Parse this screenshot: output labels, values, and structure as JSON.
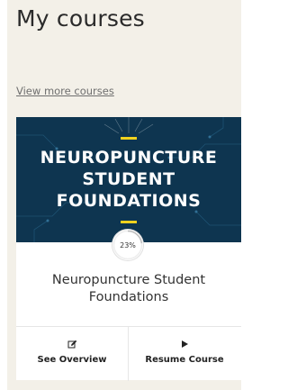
{
  "page": {
    "title": "My courses",
    "more_link": "View more courses"
  },
  "course_card": {
    "banner_lines": [
      "NEUROPUNCTURE",
      "STUDENT",
      "FOUNDATIONS"
    ],
    "banner_colors": {
      "background": "#0e3550",
      "accent": "#f0d21e"
    },
    "progress_percent": 23,
    "progress_label": "23%",
    "name": "Neuropuncture Student Foundations",
    "actions": [
      {
        "label": "See Overview",
        "icon": "edit-icon"
      },
      {
        "label": "Resume Course",
        "icon": "play-icon"
      }
    ]
  }
}
